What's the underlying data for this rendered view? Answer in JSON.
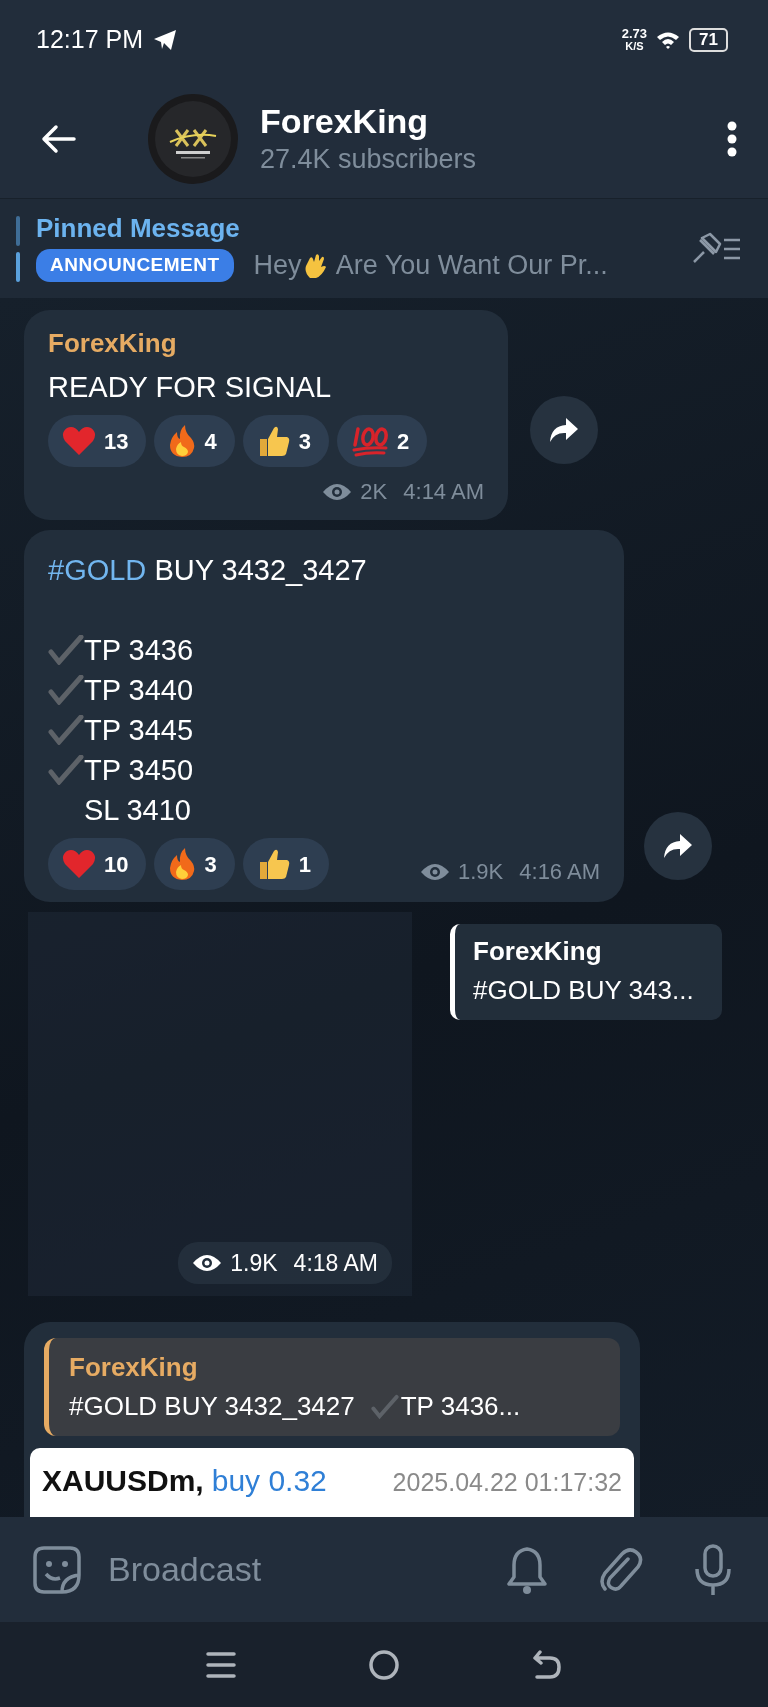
{
  "status_bar": {
    "time": "12:17 PM",
    "net_speed": "2.73",
    "net_unit": "K/S",
    "battery": "71"
  },
  "header": {
    "title": "ForexKing",
    "subtitle": "27.4K subscribers"
  },
  "pinned": {
    "title": "Pinned Message",
    "tag": "ANNOUNCEMENT",
    "preview_start": "Hey",
    "preview_end": "Are You Want Our Pr..."
  },
  "messages": [
    {
      "kind": "text",
      "author": "ForexKing",
      "text": "READY FOR SIGNAL",
      "reactions": [
        {
          "kind": "heart",
          "count": "13"
        },
        {
          "kind": "fire",
          "count": "4"
        },
        {
          "kind": "thumbs_up",
          "count": "3"
        },
        {
          "kind": "hundred",
          "count": "2"
        }
      ],
      "views": "2K",
      "time": "4:14 AM"
    },
    {
      "kind": "signal",
      "hashtag": "#GOLD",
      "headline": "BUY 3432_3427",
      "lines": [
        {
          "checked": true,
          "text": "TP 3436"
        },
        {
          "checked": true,
          "text": "TP 3440"
        },
        {
          "checked": true,
          "text": "TP 3445"
        },
        {
          "checked": true,
          "text": "TP 3450"
        },
        {
          "checked": false,
          "text": "SL 3410"
        }
      ],
      "reactions": [
        {
          "kind": "heart",
          "count": "10"
        },
        {
          "kind": "fire",
          "count": "3"
        },
        {
          "kind": "thumbs_up",
          "count": "1"
        }
      ],
      "views": "1.9K",
      "time": "4:16 AM"
    },
    {
      "kind": "media",
      "reply_to": {
        "author": "ForexKing",
        "text": "#GOLD BUY 343..."
      },
      "views": "1.9K",
      "time": "4:18 AM"
    },
    {
      "kind": "reply",
      "quote": {
        "author": "ForexKing",
        "text": "#GOLD BUY 3432_3427",
        "checked": true,
        "more": "TP 3436..."
      },
      "attachment": {
        "symbol": "XAUUSDm,",
        "action": "buy 0.32",
        "datetime": "2025.04.22 01:17:32"
      }
    }
  ],
  "composer": {
    "placeholder": "Broadcast"
  }
}
